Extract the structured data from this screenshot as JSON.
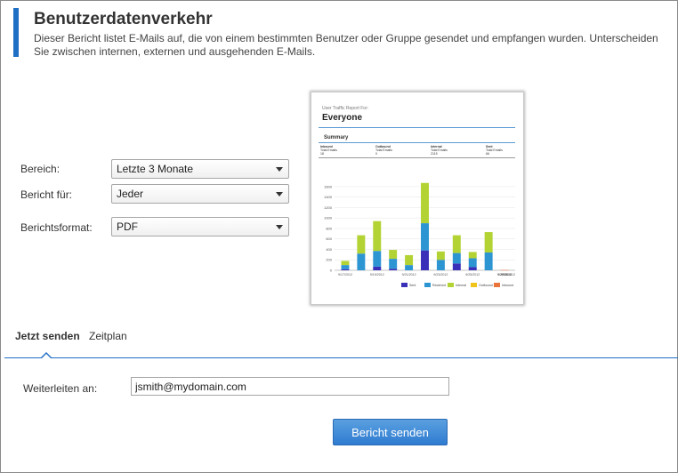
{
  "header": {
    "title": "Benutzerdatenverkehr",
    "description": "Dieser Bericht listet E-Mails auf, die von einem bestimmten Benutzer oder Gruppe gesendet und empfangen wurden. Unterscheiden Sie zwischen internen, externen und ausgehenden E-Mails."
  },
  "form": {
    "range_label": "Bereich:",
    "range_value": "Letzte 3 Monate",
    "report_for_label": "Bericht für:",
    "report_for_value": "Jeder",
    "format_label": "Berichtsformat:",
    "format_value": "PDF"
  },
  "preview": {
    "subtitle": "User Traffic Report For:",
    "title": "Everyone",
    "summary_heading": "Summary",
    "summary_columns": [
      {
        "heading": "Inbound",
        "label": "Total Emails",
        "value": "18"
      },
      {
        "heading": "Outbound",
        "label": "Total Emails",
        "value": "0"
      },
      {
        "heading": "Internal",
        "label": "Total Emails",
        "value": "2115"
      },
      {
        "heading": "Sent",
        "label": "Total Emails",
        "value": "66"
      }
    ],
    "colors": {
      "Sent": "#3a2fb8",
      "Received": "#2e95d3",
      "Internal": "#b3d334",
      "Outbound": "#f0c419",
      "Inbound": "#e8743b"
    },
    "chart_data": {
      "type": "bar",
      "stacked": true,
      "y_ticks": [
        "0",
        "200",
        "400",
        "600",
        "800",
        "1000",
        "1200",
        "1400",
        "1600"
      ],
      "ylim": [
        0,
        1700
      ],
      "x_tick_labels": [
        "9/17/2012",
        "9/19/2012",
        "9/21/2012",
        "9/23/2012",
        "9/25/2012",
        "9/27/2012",
        "9/29/2012",
        "9/30/2012"
      ],
      "legend": [
        "Sent",
        "Received",
        "Internal",
        "Outbound",
        "Inbound"
      ],
      "legend_position": "bottom-right",
      "grid": true,
      "series": [
        {
          "name": "Sent",
          "values": [
            20,
            0,
            70,
            30,
            0,
            380,
            0,
            130,
            60,
            0,
            0
          ]
        },
        {
          "name": "Received",
          "values": [
            80,
            320,
            300,
            190,
            100,
            520,
            200,
            200,
            170,
            340,
            0
          ]
        },
        {
          "name": "Internal",
          "values": [
            80,
            350,
            570,
            170,
            190,
            770,
            160,
            340,
            120,
            390,
            0
          ]
        },
        {
          "name": "Outbound",
          "values": [
            0,
            0,
            0,
            0,
            0,
            0,
            0,
            0,
            0,
            0,
            0
          ]
        },
        {
          "name": "Inbound",
          "values": [
            0,
            0,
            0,
            0,
            0,
            0,
            0,
            0,
            0,
            0,
            5
          ]
        }
      ]
    }
  },
  "tabs": [
    {
      "label": "Jetzt senden",
      "active": true
    },
    {
      "label": "Zeitplan",
      "active": false
    }
  ],
  "forward": {
    "label": "Weiterleiten an:",
    "value": "jsmith@mydomain.com"
  },
  "send_button": "Bericht senden"
}
